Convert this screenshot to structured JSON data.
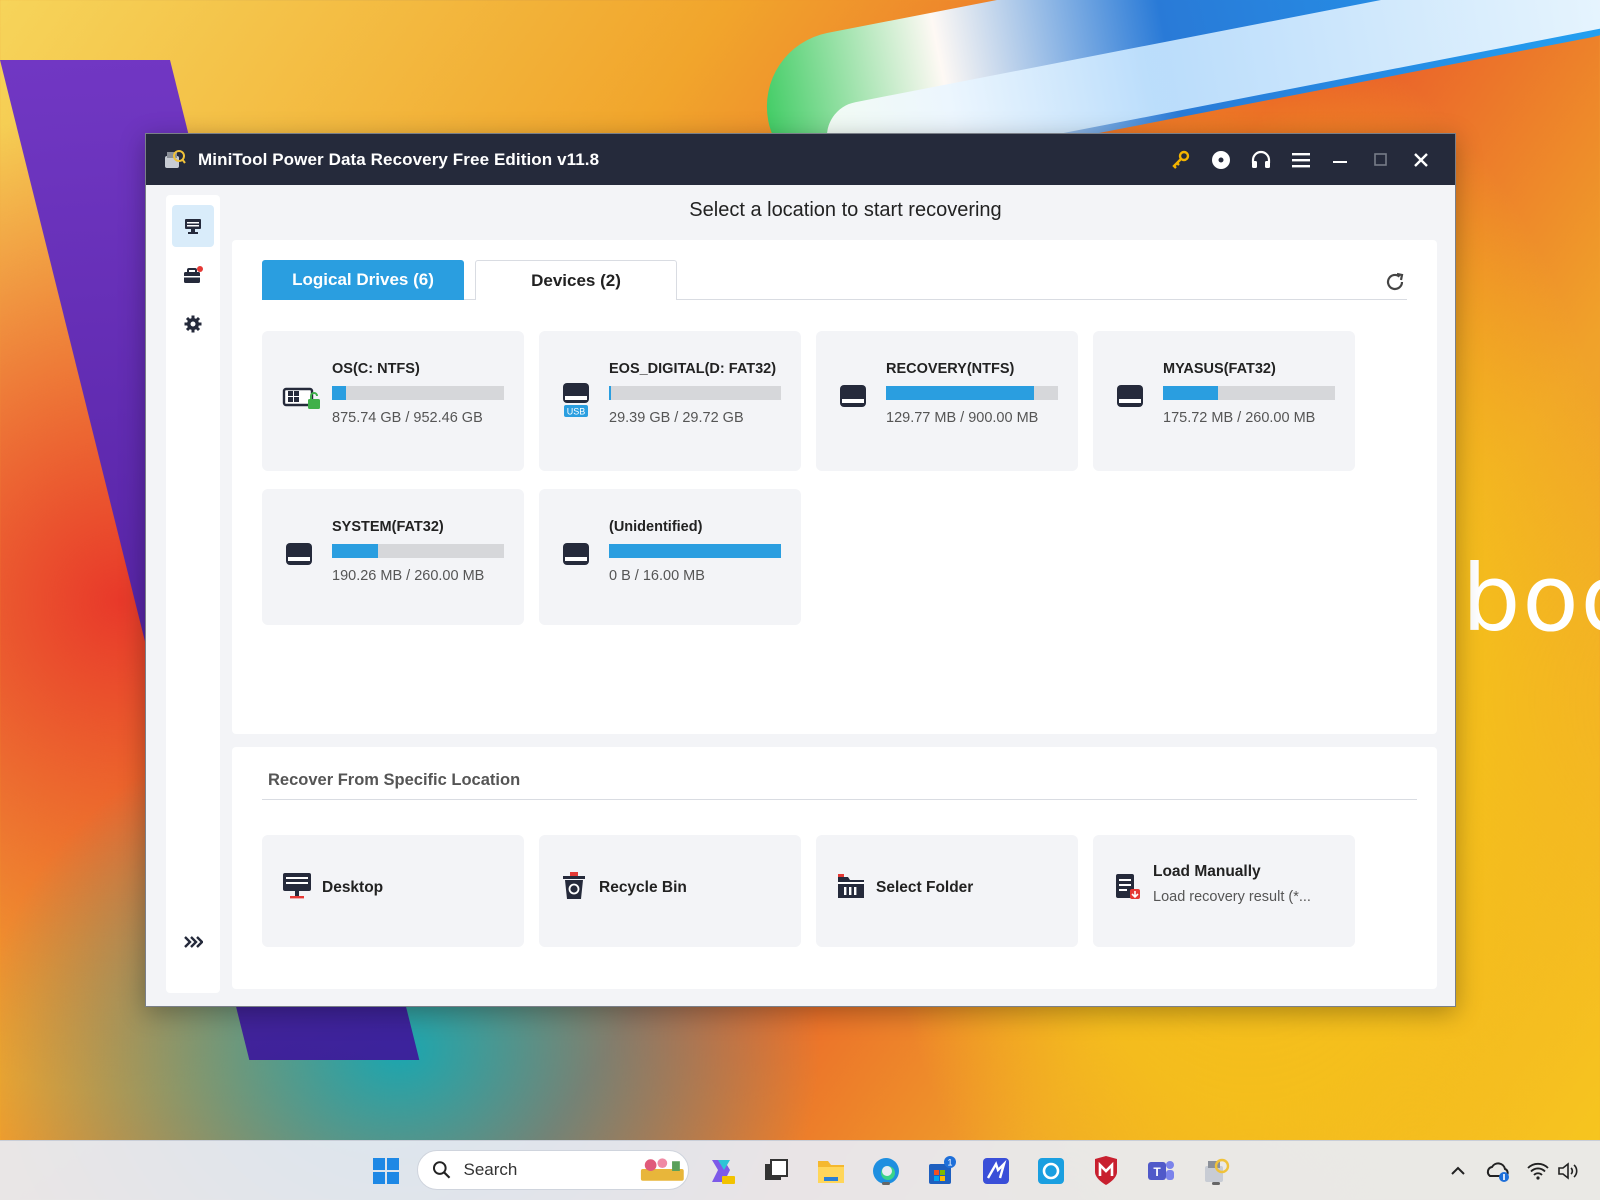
{
  "window": {
    "title": "MiniTool Power Data Recovery Free Edition v11.8"
  },
  "wallpaper_text": "boo",
  "heading": "Select a location to start recovering",
  "tabs": [
    {
      "label": "Logical Drives (6)",
      "active": true
    },
    {
      "label": "Devices (2)",
      "active": false
    }
  ],
  "drives": [
    {
      "name": "OS(C: NTFS)",
      "size": "875.74 GB / 952.46 GB",
      "usage": 0.08,
      "icon": "windows-drive-icon"
    },
    {
      "name": "EOS_DIGITAL(D: FAT32)",
      "size": "29.39 GB / 29.72 GB",
      "usage": 0.01,
      "icon": "usb-drive-icon",
      "badge": "USB"
    },
    {
      "name": "RECOVERY(NTFS)",
      "size": "129.77 MB / 900.00 MB",
      "usage": 0.86,
      "icon": "drive-icon"
    },
    {
      "name": "MYASUS(FAT32)",
      "size": "175.72 MB / 260.00 MB",
      "usage": 0.32,
      "icon": "drive-icon"
    },
    {
      "name": "SYSTEM(FAT32)",
      "size": "190.26 MB / 260.00 MB",
      "usage": 0.27,
      "icon": "drive-icon"
    },
    {
      "name": "(Unidentified)",
      "size": "0 B / 16.00 MB",
      "usage": 1.0,
      "icon": "drive-icon"
    }
  ],
  "specific": {
    "title": "Recover From Specific Location",
    "items": [
      {
        "label": "Desktop",
        "icon": "desktop-icon"
      },
      {
        "label": "Recycle Bin",
        "icon": "recycle-bin-icon"
      },
      {
        "label": "Select Folder",
        "icon": "folder-icon"
      },
      {
        "label": "Load Manually",
        "sub": "Load recovery result (*...",
        "icon": "load-file-icon"
      }
    ]
  },
  "taskbar": {
    "search_label": "Search"
  },
  "colors": {
    "accent": "#2a9ee0",
    "titlebar": "#252a3b",
    "bar_bg": "#d6d7da"
  }
}
